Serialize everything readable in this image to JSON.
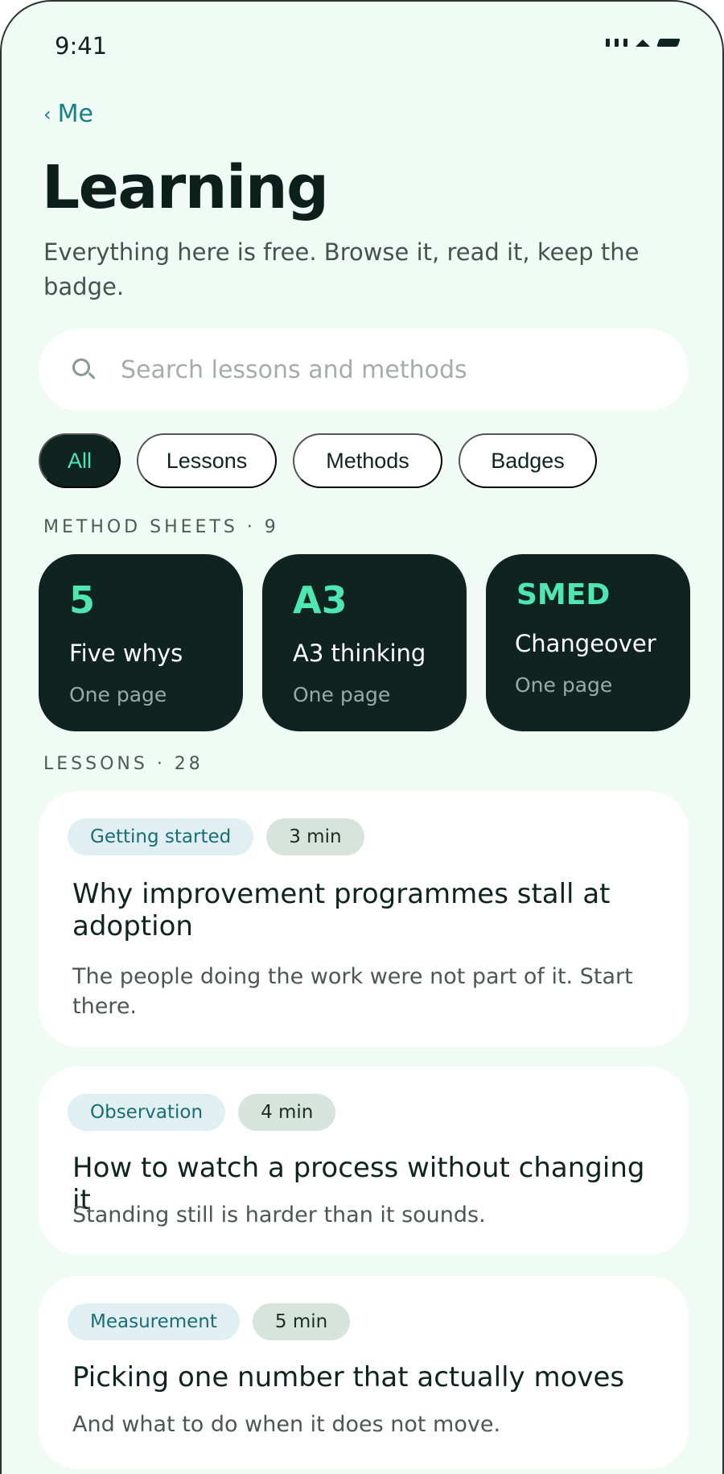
{
  "status_bar": {
    "time": "9:41"
  },
  "nav": {
    "back_label": "Me",
    "back_chevron": "‹"
  },
  "page": {
    "title": "Learning",
    "subtitle": "Everything here is free. Browse it, read it, keep the badge."
  },
  "search": {
    "placeholder": "Search lessons and methods",
    "value": "",
    "icon": "search-icon"
  },
  "filters": [
    {
      "label": "All",
      "active": true
    },
    {
      "label": "Lessons",
      "active": false
    },
    {
      "label": "Methods",
      "active": false
    },
    {
      "label": "Badges",
      "active": false
    }
  ],
  "method_sheets": {
    "label": "METHOD SHEETS · 9",
    "items": [
      {
        "code": "5",
        "name": "Five whys",
        "length": "One page"
      },
      {
        "code": "A3",
        "name": "A3 thinking",
        "length": "One page"
      },
      {
        "code": "SMED",
        "name": "Changeover",
        "length": "One page"
      }
    ]
  },
  "lessons": {
    "label": "LESSONS · 28",
    "items": [
      {
        "topic": "Getting started",
        "duration": "3 min",
        "title": "Why improvement programmes stall at adoption",
        "description": "The people doing the work were not part of it. Start there."
      },
      {
        "topic": "Observation",
        "duration": "4 min",
        "title": "How to watch a process without changing it",
        "description": "Standing still is harder than it sounds."
      },
      {
        "topic": "Measurement",
        "duration": "5 min",
        "title": "Picking one number that actually moves",
        "description": "And what to do when it does not move."
      }
    ]
  },
  "colors": {
    "background": "#f0fbf6",
    "dark": "#0f2420",
    "accent": "#4fe6b2",
    "link": "#137f86"
  }
}
